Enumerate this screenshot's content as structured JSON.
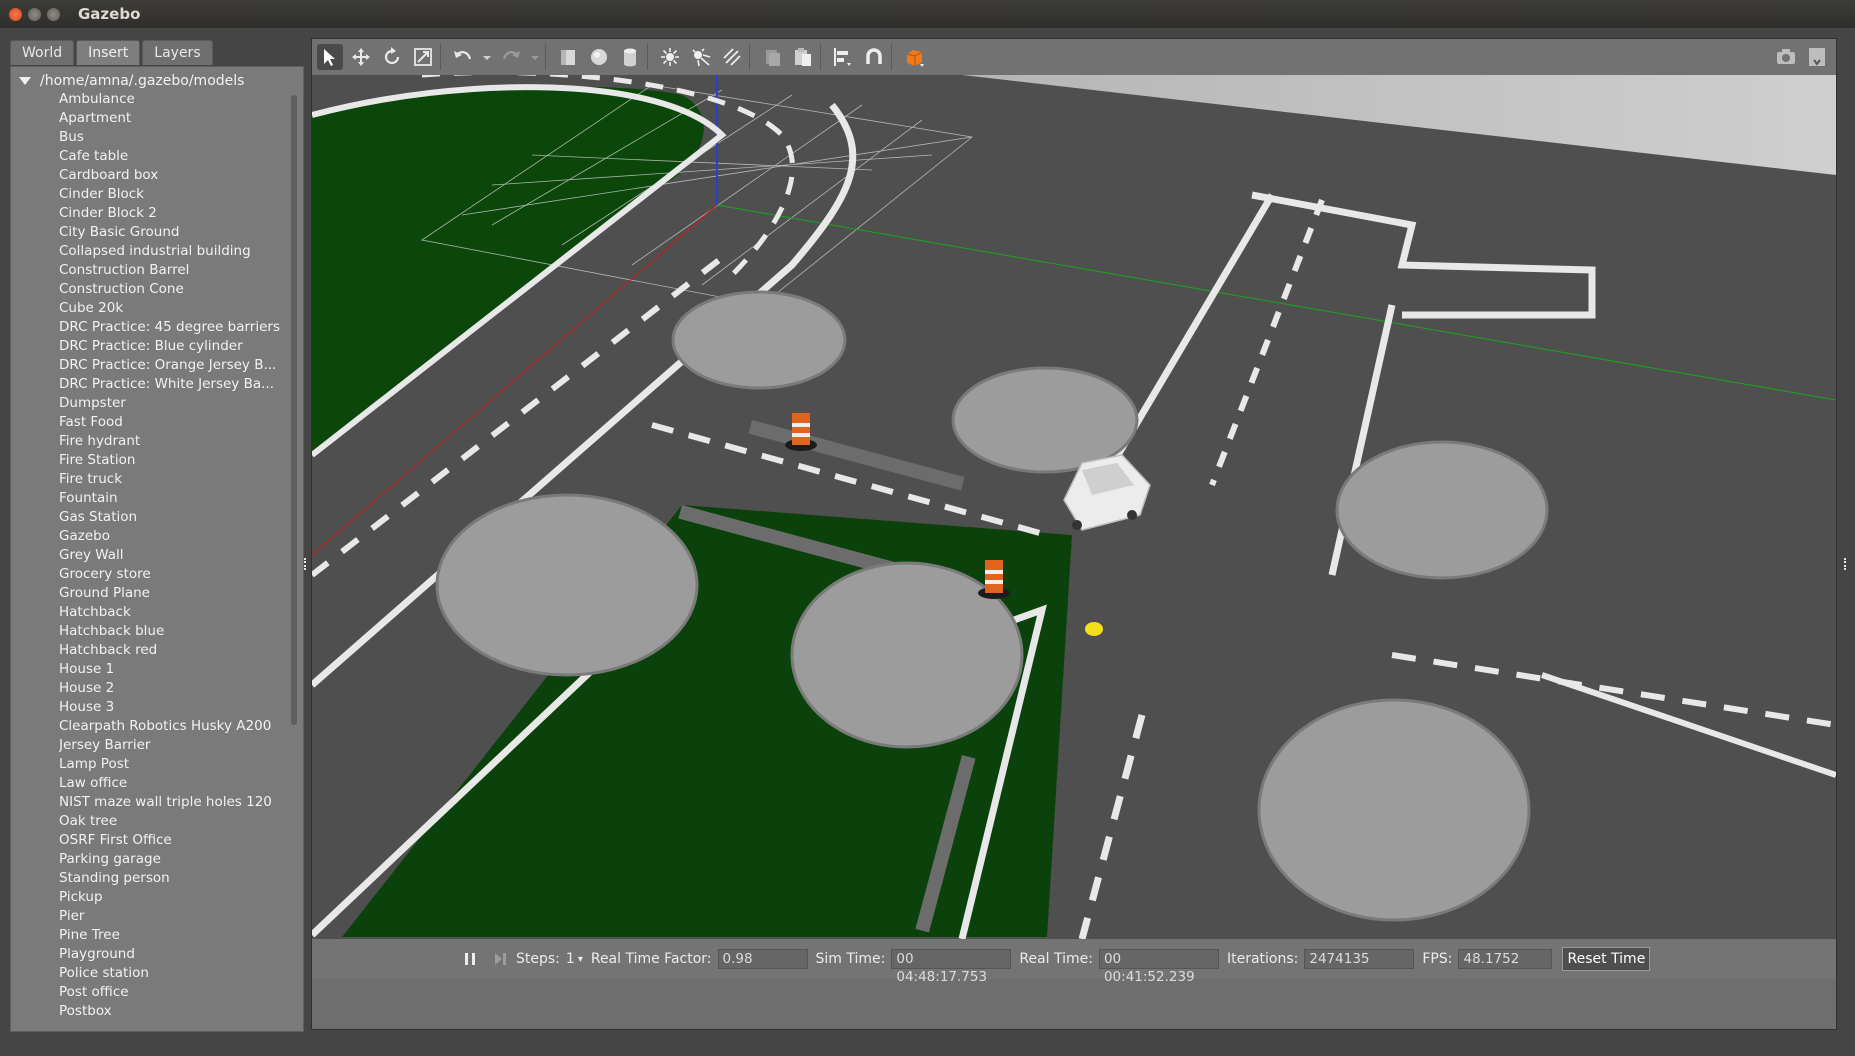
{
  "window": {
    "title": "Gazebo"
  },
  "tabs": [
    "World",
    "Insert",
    "Layers"
  ],
  "models": {
    "root": "/home/amna/.gazebo/models",
    "items": [
      "Ambulance",
      "Apartment",
      "Bus",
      "Cafe table",
      "Cardboard box",
      "Cinder Block",
      "Cinder Block 2",
      "City Basic Ground",
      "Collapsed industrial building",
      "Construction Barrel",
      "Construction Cone",
      "Cube 20k",
      "DRC Practice: 45 degree barriers",
      "DRC Practice: Blue cylinder",
      "DRC Practice: Orange Jersey B...",
      "DRC Practice: White Jersey Ba...",
      "Dumpster",
      "Fast Food",
      "Fire hydrant",
      "Fire Station",
      "Fire truck",
      "Fountain",
      "Gas Station",
      "Gazebo",
      "Grey Wall",
      "Grocery store",
      "Ground Plane",
      "Hatchback",
      "Hatchback blue",
      "Hatchback red",
      "House 1",
      "House 2",
      "House 3",
      "Clearpath Robotics Husky A200",
      "Jersey Barrier",
      "Lamp Post",
      "Law office",
      "NIST maze wall triple holes 120",
      "Oak tree",
      "OSRF First Office",
      "Parking garage",
      "Standing person",
      "Pickup",
      "Pier",
      "Pine Tree",
      "Playground",
      "Police station",
      "Post office",
      "Postbox"
    ]
  },
  "toolbar": {
    "icons": [
      "select-icon",
      "translate-icon",
      "rotate-icon",
      "scale-icon",
      "undo-icon",
      "undo-dropdown-icon",
      "redo-icon",
      "redo-dropdown-icon",
      "box-icon",
      "sphere-icon",
      "cylinder-icon",
      "point-light-icon",
      "spot-light-icon",
      "directional-light-icon",
      "copy-icon",
      "paste-icon",
      "align-icon",
      "snap-icon",
      "view-angle-icon",
      "screenshot-icon",
      "log-icon"
    ],
    "accent": "#f07a1a"
  },
  "status": {
    "steps_label": "Steps:",
    "steps_value": "1",
    "rtf_label": "Real Time Factor:",
    "rtf_value": "0.98",
    "sim_time_label": "Sim Time:",
    "sim_time_value": "00 04:48:17.753",
    "real_time_label": "Real Time:",
    "real_time_value": "00 00:41:52.239",
    "iterations_label": "Iterations:",
    "iterations_value": "2474135",
    "fps_label": "FPS:",
    "fps_value": "48.1752",
    "reset_label": "Reset Time"
  },
  "colors": {
    "road": "#555555",
    "grass": "#0c4a0c",
    "platform": "#9a9a9a",
    "cone": "#e0641e"
  }
}
